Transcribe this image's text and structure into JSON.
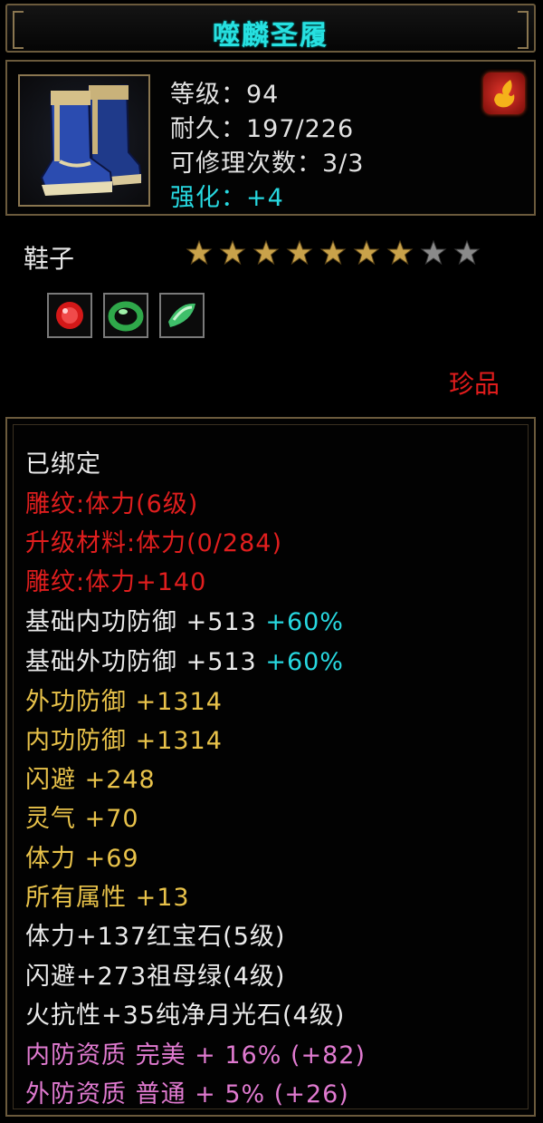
{
  "title": "噬麟圣履",
  "header": {
    "level": "等级：94",
    "durability": "耐久：197/226",
    "repair": "可修理次数：3/3",
    "enhance": "强化：+4"
  },
  "item_type": "鞋子",
  "stars": {
    "filled": 7,
    "total": 9
  },
  "gems": [
    "ruby-gem-icon",
    "emerald-ring-gem-icon",
    "jade-gem-icon"
  ],
  "rarity": "珍品",
  "attributes": {
    "bound": "已绑定",
    "engrave_level": "雕纹:体力(6级)",
    "upgrade_material": "升级材料:体力(0/284)",
    "engrave_bonus": "雕纹:体力+140",
    "base_inner_def": "基础内功防御 +513 ",
    "base_inner_def_pct": "+60%",
    "base_outer_def": "基础外功防御 +513 ",
    "base_outer_def_pct": "+60%",
    "outer_def": "外功防御 +1314",
    "inner_def": "内功防御 +1314",
    "dodge": "闪避 +248",
    "spirit": "灵气 +70",
    "stamina": "体力 +69",
    "all_attr": "所有属性 +13",
    "gem_ruby": "体力+137红宝石(5级)",
    "gem_emerald": "闪避+273祖母绿(4级)",
    "gem_moonstone": "火抗性+35纯净月光石(4级)",
    "inner_quality": "内防资质 完美 + 16% (+82)",
    "outer_quality": "外防资质 普通 + 5% (+26)"
  },
  "colors": {
    "title": "#27e0e0",
    "red": "#e01e1e",
    "gold": "#e8c24a",
    "pink": "#e07ad0",
    "cyan": "#27d8e0"
  }
}
